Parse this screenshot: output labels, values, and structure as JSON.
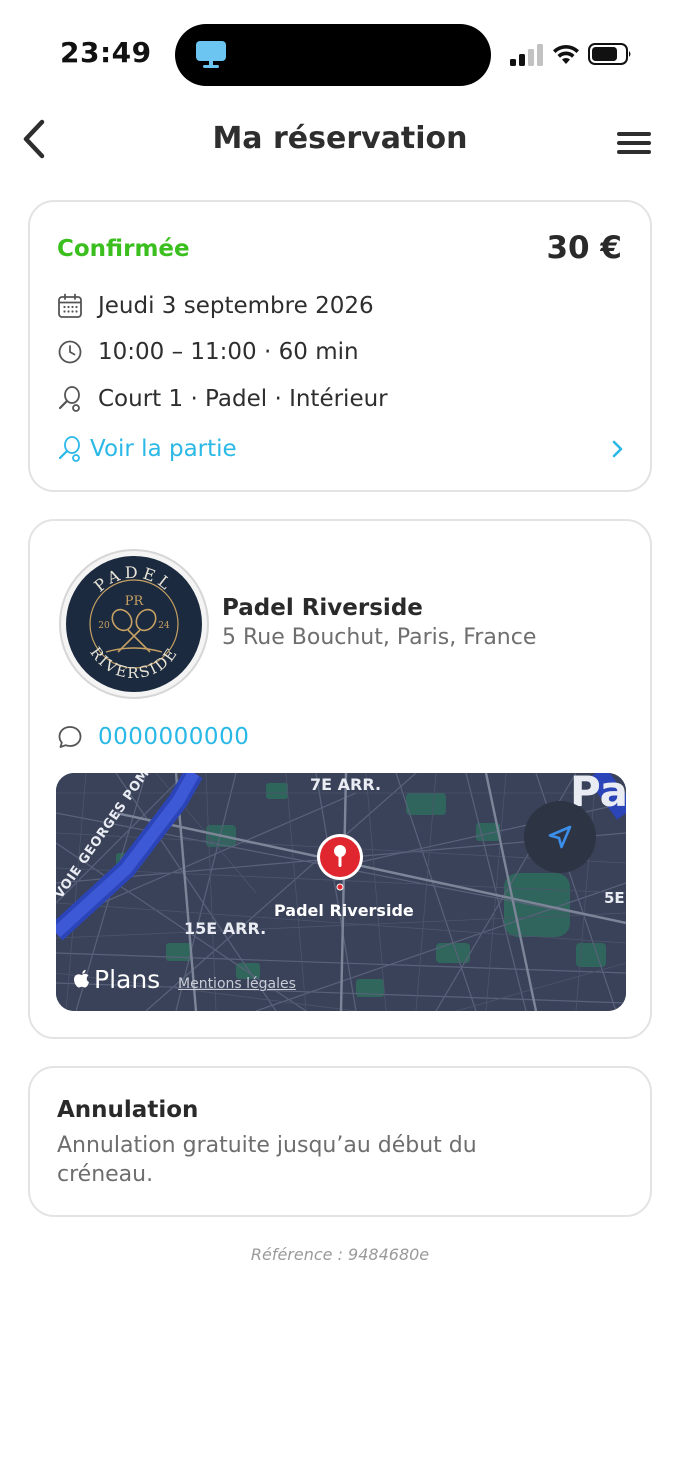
{
  "status_bar": {
    "time": "23:49"
  },
  "header": {
    "title": "Ma réservation"
  },
  "booking": {
    "status": "Confirmée",
    "status_color": "#3bbf1f",
    "price": "30 €",
    "date": "Jeudi 3 septembre 2026",
    "time_range": "10:00 – 11:00 · 60 min",
    "court": "Court 1 · Padel · Intérieur",
    "link_label": "Voir la partie",
    "link_color": "#2ab8e6"
  },
  "club": {
    "name": "Padel Riverside",
    "address": "5 Rue Bouchut, Paris, France",
    "phone": "0000000000",
    "logo": {
      "top_text": "PADEL",
      "bottom_text": "RIVERSIDE",
      "monogram": "PR",
      "year_left": "20",
      "year_right": "24"
    }
  },
  "map": {
    "labels": {
      "district_7": "7E ARR.",
      "district_15": "15E ARR.",
      "district_5": "5E",
      "city": "Pa",
      "street": "VOIE GEORGES POMPIDOU",
      "pin": "Padel Riverside"
    },
    "brand": "Plans",
    "legal": "Mentions légales"
  },
  "cancellation": {
    "title": "Annulation",
    "text": "Annulation gratuite jusqu’au début du créneau."
  },
  "reference": "Référence : 9484680e"
}
